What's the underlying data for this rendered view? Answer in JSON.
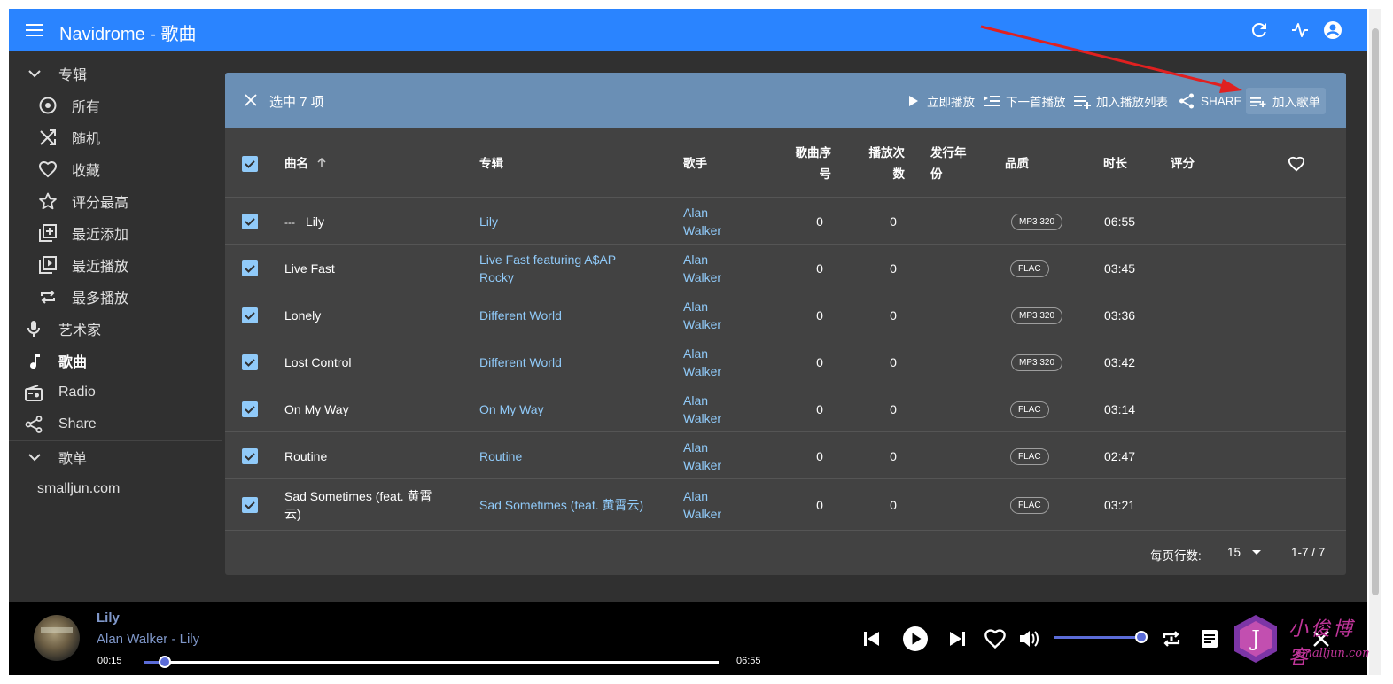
{
  "app": {
    "title": "Navidrome - 歌曲"
  },
  "sidebar": {
    "albums_header": "专辑",
    "album_items": [
      {
        "label": "所有",
        "icon": "album-icon"
      },
      {
        "label": "随机",
        "icon": "shuffle-icon"
      },
      {
        "label": "收藏",
        "icon": "heart-icon"
      },
      {
        "label": "评分最高",
        "icon": "star-icon"
      },
      {
        "label": "最近添加",
        "icon": "library-add-icon"
      },
      {
        "label": "最近播放",
        "icon": "video-library-icon"
      },
      {
        "label": "最多播放",
        "icon": "repeat-icon"
      }
    ],
    "artists": "艺术家",
    "songs": "歌曲",
    "radio": "Radio",
    "share": "Share",
    "playlists_header": "歌单",
    "playlist_items": [
      "smalljun.com"
    ]
  },
  "bulk": {
    "selected": "选中 7 项",
    "play_now": "立即播放",
    "play_next": "下一首播放",
    "add_to_queue": "加入播放列表",
    "share": "SHARE",
    "add_to_playlist": "加入歌单"
  },
  "table": {
    "headers": {
      "title": "曲名",
      "album": "专辑",
      "artist": "歌手",
      "track_1": "歌曲序",
      "track_2": "号",
      "plays_1": "播放次",
      "plays_2": "数",
      "year_1": "发行年",
      "year_2": "份",
      "quality": "品质",
      "duration": "时长",
      "rating": "评分"
    },
    "rows": [
      {
        "prefix": "---",
        "title": "Lily",
        "title2": "",
        "album": "Lily",
        "album2": "",
        "artist1": "Alan",
        "artist2": "Walker",
        "track": "0",
        "plays": "0",
        "quality": "MP3 320",
        "duration": "06:55"
      },
      {
        "prefix": "",
        "title": "Live Fast",
        "title2": "",
        "album": "Live Fast featuring A$AP",
        "album2": "Rocky",
        "artist1": "Alan",
        "artist2": "Walker",
        "track": "0",
        "plays": "0",
        "quality": "FLAC",
        "duration": "03:45"
      },
      {
        "prefix": "",
        "title": "Lonely",
        "title2": "",
        "album": "Different World",
        "album2": "",
        "artist1": "Alan",
        "artist2": "Walker",
        "track": "0",
        "plays": "0",
        "quality": "MP3 320",
        "duration": "03:36"
      },
      {
        "prefix": "",
        "title": "Lost Control",
        "title2": "",
        "album": "Different World",
        "album2": "",
        "artist1": "Alan",
        "artist2": "Walker",
        "track": "0",
        "plays": "0",
        "quality": "MP3 320",
        "duration": "03:42"
      },
      {
        "prefix": "",
        "title": "On My Way",
        "title2": "",
        "album": "On My Way",
        "album2": "",
        "artist1": "Alan",
        "artist2": "Walker",
        "track": "0",
        "plays": "0",
        "quality": "FLAC",
        "duration": "03:14"
      },
      {
        "prefix": "",
        "title": "Routine",
        "title2": "",
        "album": "Routine",
        "album2": "",
        "artist1": "Alan",
        "artist2": "Walker",
        "track": "0",
        "plays": "0",
        "quality": "FLAC",
        "duration": "02:47"
      },
      {
        "prefix": "",
        "title": "Sad Sometimes (feat. 黄霄",
        "title2": "云)",
        "album": "Sad Sometimes (feat. 黄霄云)",
        "album2": "",
        "artist1": "Alan",
        "artist2": "Walker",
        "track": "0",
        "plays": "0",
        "quality": "FLAC",
        "duration": "03:21"
      }
    ]
  },
  "pagination": {
    "rows_per_page_label": "每页行数:",
    "rows_per_page": "15",
    "range": "1-7 / 7"
  },
  "player": {
    "title": "Lily",
    "subtitle": "Alan Walker - Lily",
    "elapsed": "00:15",
    "total": "06:55",
    "progress": 0.036,
    "volume": 1.0
  },
  "watermark": {
    "text": "小俊博客",
    "url": "smalljun.com"
  },
  "colors": {
    "appbar": "#2a84ff",
    "bulkbar": "#6a8fb5",
    "link": "#90caf9",
    "accent": "#5b6cd8",
    "annotation_arrow": "#e02020"
  }
}
